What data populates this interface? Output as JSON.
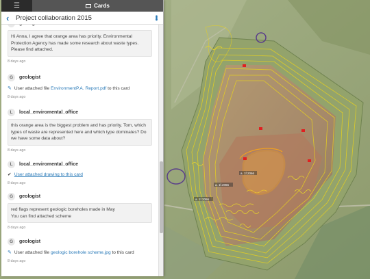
{
  "topbar": {
    "menu_icon": "hamburger-icon",
    "cards_tab_label": "Cards"
  },
  "header": {
    "title": "Project collaboration 2015"
  },
  "feed": [
    {
      "type": "comment",
      "author": "geologist",
      "avatar": "G",
      "text": "Hi Anna, I agree that orange area has priority. Environmental Protection Agency has made some research about  waste types. Please find attached.",
      "time": "8 days ago"
    },
    {
      "type": "file",
      "author": "geologist",
      "avatar": "G",
      "action_prefix": "User attached file",
      "file": "EnvironmentP.A. Report.pdf",
      "action_suffix": "to this card",
      "time": "8 days ago"
    },
    {
      "type": "comment",
      "author": "local_enviromental_office",
      "avatar": "L",
      "text": "this orange area is the biggest problem and has priority. Tom, which types of waste are represented here and which type dominates? Do we have some data about?",
      "time": "8 days ago"
    },
    {
      "type": "drawing",
      "author": "local_enviromental_office",
      "avatar": "L",
      "action": "User attached drawing to this card",
      "time": "8 days ago"
    },
    {
      "type": "comment",
      "author": "geologist",
      "avatar": "G",
      "text_line1": "red flags represent geologic boreholes made in May",
      "text_line2": "You can find attached scheme",
      "time": "8 days ago"
    },
    {
      "type": "file",
      "author": "geologist",
      "avatar": "G",
      "action_prefix": "User attached file",
      "file": "geologic borehole scheme.jpg",
      "action_suffix": "to this card",
      "time": "8 days ago"
    }
  ],
  "top_partial_author": "geologist",
  "map_labels": [
    "a. 1f.2066",
    "a. 1f.2066",
    "a. 1f.2066"
  ],
  "colors": {
    "accent": "#2b7bb9",
    "orange_area": "#f0a020",
    "contour": "#e6d020",
    "flag": "#e02020",
    "drawing": "#5a3f8a"
  }
}
